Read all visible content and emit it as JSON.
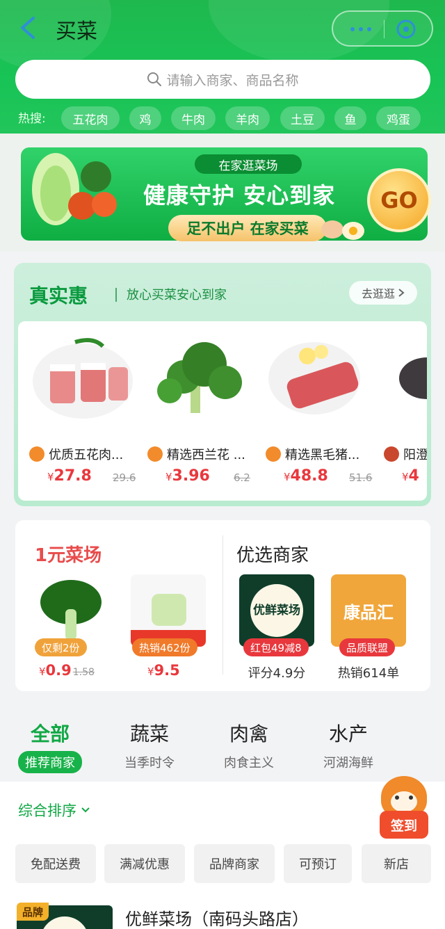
{
  "header": {
    "title": "买菜",
    "search_placeholder": "请输入商家、商品名称",
    "hot_label": "热搜:",
    "hot_tags": [
      "五花肉",
      "鸡",
      "牛肉",
      "羊肉",
      "土豆",
      "鱼",
      "鸡蛋"
    ]
  },
  "banner": {
    "ribbon": "在家逛菜场",
    "headline": "健康守护 安心到家",
    "pill": "足不出户 在家买菜",
    "go": "GO"
  },
  "deal": {
    "title": "真实惠",
    "slogan": "放心买菜安心到家",
    "more": "去逛逛",
    "products": [
      {
        "name": "优质五花肉...",
        "price": "27.8",
        "old": "29.6"
      },
      {
        "name": "精选西兰花 ...",
        "price": "3.96",
        "old": "6.2"
      },
      {
        "name": "精选黑毛猪...",
        "price": "48.8",
        "old": "51.6"
      },
      {
        "name": "阳澄",
        "price": "4",
        "old": ""
      }
    ],
    "currency": "¥"
  },
  "promo": {
    "one_yuan_title": "1元菜场",
    "picks_title": "优选商家",
    "one_yuan_items": [
      {
        "badge": "仅剩2份",
        "price": "0.9",
        "old": "1.58"
      },
      {
        "badge": "热销462份",
        "price": "9.5",
        "old": ""
      }
    ],
    "merchants": [
      {
        "logo_text": "优鲜菜场",
        "badge": "红包49减8",
        "stat": "评分4.9分"
      },
      {
        "logo_text": "康品汇",
        "badge": "品质联盟",
        "stat": "热销614单"
      }
    ],
    "currency": "¥"
  },
  "categories": [
    {
      "main": "全部",
      "sub": "推荐商家",
      "active": true
    },
    {
      "main": "蔬菜",
      "sub": "当季时令",
      "active": false
    },
    {
      "main": "肉禽",
      "sub": "肉食主义",
      "active": false
    },
    {
      "main": "水产",
      "sub": "河湖海鲜",
      "active": false
    }
  ],
  "filter": {
    "sort": "综合排序",
    "chips": [
      "免配送费",
      "满减优惠",
      "品牌商家",
      "可预订",
      "新店"
    ]
  },
  "store": {
    "tag": "品牌",
    "name": "优鲜菜场（南码头路店）"
  },
  "sign_in": "签到",
  "colors": {
    "brand_green": "#18c456",
    "price_red": "#e8383d",
    "accent_orange": "#f5a623"
  }
}
